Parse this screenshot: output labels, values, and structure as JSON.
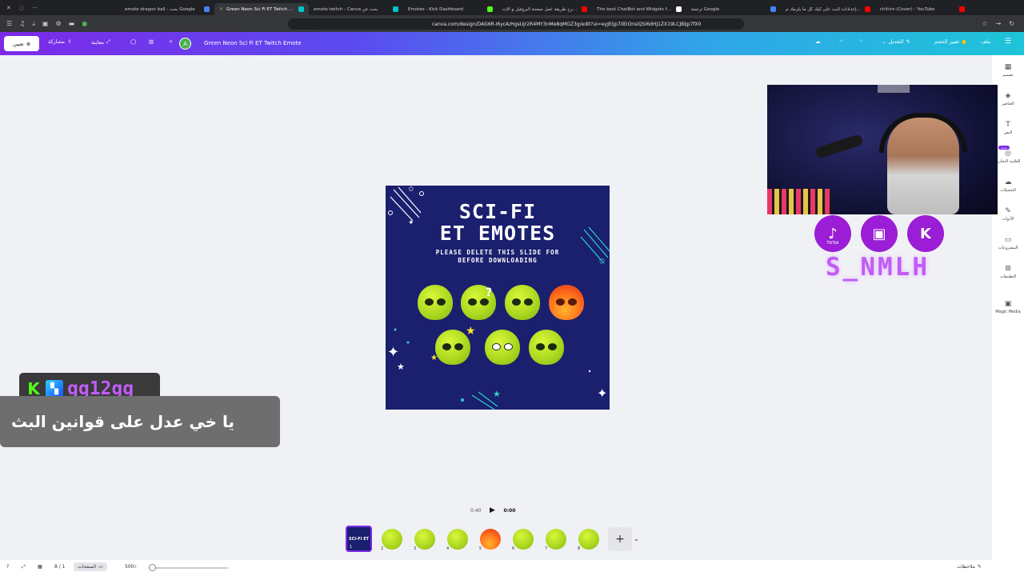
{
  "browser": {
    "tabs": [
      {
        "title": "emote dragon ball - بحث Google",
        "fav": "#4285f4",
        "active": false
      },
      {
        "title": "Green Neon Sci Fi ET Twitch Emote",
        "fav": "#00c4cc",
        "active": true
      },
      {
        "title": "emote twitch - Canva بحث عن",
        "fav": "#00c4cc",
        "active": false
      },
      {
        "title": "Emotes - Kick Dashboard",
        "fav": "#53fc18",
        "active": false
      },
      {
        "title": "شرح طريقة عمل صفحة البروفيل و الإت...",
        "fav": "#ff0000",
        "active": false
      },
      {
        "title": "The best ChatBot and Widgets for Ki...",
        "fav": "#ffffff",
        "active": false
      },
      {
        "title": "ترجمة Google",
        "fav": "#4285f4",
        "active": false
      },
      {
        "title": "إعدادات البث على كيك كل ما يلزمك م...",
        "fav": "#ff0000",
        "active": false
      },
      {
        "title": "chihiro (Cover) - YouTube",
        "fav": "#ff0000",
        "active": false
      }
    ],
    "url": "canva.com/design/DAG6R-I6ycA/HgsUjr2R4MY3nMe8qMGZ3g/edit?ui=eyJEIjp7IlEiOnsiQSI6dHJ1ZX19LCJBIjp7fX0"
  },
  "canva": {
    "share_btn": "تعيين",
    "share_label": "مشاركة",
    "preview_label": "معاينة",
    "avatar_letter": "A",
    "design_title": "Green Neon Sci Fi ET Twitch Emote",
    "edit_label": "التعديل",
    "resize_label": "تغيير الحجم",
    "file_label": "ملف"
  },
  "sidebar": {
    "items": [
      {
        "label": "تصميم",
        "icon": "▦"
      },
      {
        "label": "العناصر",
        "icon": "◈"
      },
      {
        "label": "النص",
        "icon": "T"
      },
      {
        "label": "العلامة التجارية",
        "icon": "◎"
      },
      {
        "label": "التحميلات",
        "icon": "☁"
      },
      {
        "label": "الأدوات",
        "icon": "✎"
      },
      {
        "label": "المشروعات",
        "icon": "▭"
      },
      {
        "label": "التطبيقات",
        "icon": "⊞"
      },
      {
        "label": "Magic Media",
        "icon": "▣"
      }
    ],
    "badge": "جديد"
  },
  "design": {
    "title_line1": "SCI-FI",
    "title_line2": "ET EMOTES",
    "subtitle_line1": "PLEASE DELETE THIS SLIDE FOR",
    "subtitle_line2": "BEFORE DOWNLOADING"
  },
  "overlay": {
    "social": [
      {
        "label": "TikTok",
        "glyph": "♪"
      },
      {
        "label": "",
        "glyph": "▣"
      },
      {
        "label": "",
        "glyph": "K"
      }
    ],
    "handle": "S_NMLH",
    "chat_user": "gg12gg",
    "chat_message": "يا خي عدل على قوانين البث"
  },
  "playback": {
    "duration": "0:40",
    "current": "0:00"
  },
  "thumbnails": {
    "first_text": "SCI-FI ET",
    "pages": [
      "1",
      "2",
      "3",
      "4",
      "5",
      "6",
      "7",
      "8"
    ]
  },
  "bottom": {
    "page_counter": "8 / 1",
    "pages_label": "الصفحات",
    "zoom": "500٪",
    "notes_label": "ملاحظات"
  }
}
